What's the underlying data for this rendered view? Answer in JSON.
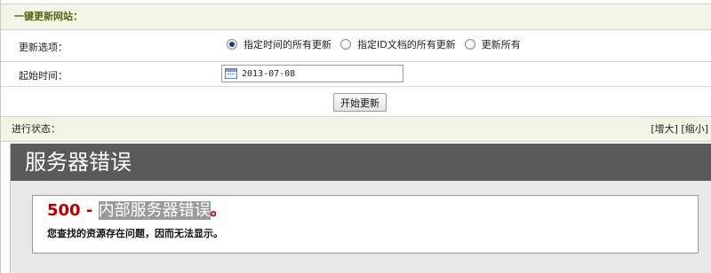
{
  "section": {
    "title": "一键更新网站："
  },
  "options_row": {
    "label": "更新选项：",
    "radios": [
      {
        "label": "指定时间的所有更新",
        "checked": true
      },
      {
        "label": "指定ID文档的所有更新",
        "checked": false
      },
      {
        "label": "更新所有",
        "checked": false
      }
    ]
  },
  "time_row": {
    "label": "起始时间：",
    "value": "2013-07-08"
  },
  "actions": {
    "start_label": "开始更新"
  },
  "status": {
    "label": "进行状态：",
    "enlarge": "[增大]",
    "shrink": "[缩小]"
  },
  "error": {
    "header": "服务器错误",
    "code": "500 - ",
    "message_highlight": "内部服务器错误",
    "message_tail": "。",
    "description": "您查找的资源存在问题，因而无法显示。",
    "colors": {
      "code": "#b50000",
      "header_bg": "#5a5a5a"
    }
  }
}
